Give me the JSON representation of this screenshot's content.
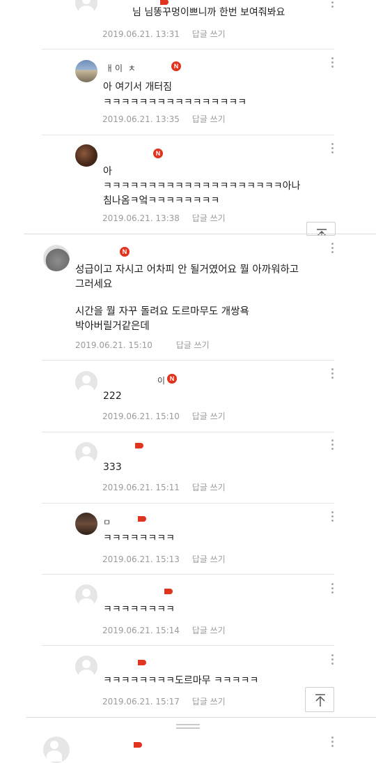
{
  "comments": [
    {
      "text": "님 님똥꾸멍이쁘니까 한번 보여줘봐요",
      "date": "2019.06.21. 13:31",
      "reply": "답글 쓰기"
    },
    {
      "nick": "ㅐ이 ㅊ",
      "badge": "N",
      "text": "아 여기서 개터짐\nㅋㅋㅋㅋㅋㅋㅋㅋㅋㅋㅋㅋㅋㅋㅋㅋ",
      "date": "2019.06.21. 13:35",
      "reply": "답글 쓰기"
    },
    {
      "badge": "N",
      "text": "아\nㅋㅋㅋㅋㅋㅋㅋㅋㅋㅋㅋㅋㅋㅋㅋㅋㅋㅋㅋㅋ아나\n침나옴ㅋ엌ㅋㅋㅋㅋㅋㅋㅋㅋ",
      "date": "2019.06.21. 13:38",
      "reply": "답글 쓰기"
    },
    {
      "badge": "N",
      "text_lines": [
        "성급이고 자시고 어차피 안 될거였어요 뭘 아까워하고",
        "그러세요",
        "",
        "시간을 뭘 자꾸 돌려요 도르마무도 개쌍욕",
        "박아버릴거같은데"
      ],
      "date": "2019.06.21. 15:10",
      "reply": "답글 쓰기"
    },
    {
      "nick": "이",
      "badge": "N",
      "text": "222",
      "date": "2019.06.21. 15:10",
      "reply": "답글 쓰기"
    },
    {
      "text": "333",
      "date": "2019.06.21. 15:11",
      "reply": "답글 쓰기"
    },
    {
      "nick": "ㅁ",
      "text": "ㅋㅋㅋㅋㅋㅋㅋㅋ",
      "date": "2019.06.21. 15:13",
      "reply": "답글 쓰기"
    },
    {
      "text": "ㅋㅋㅋㅋㅋㅋㅋㅋ",
      "date": "2019.06.21. 15:14",
      "reply": "답글 쓰기"
    },
    {
      "text": "ㅋㅋㅋㅋㅋㅋㅋㅋ도르마무 ㅋㅋㅋㅋㅋ",
      "date": "2019.06.21. 15:17",
      "reply": "답글 쓰기"
    }
  ],
  "icons": {
    "more": "more-vertical-icon",
    "scroll_top": "arrow-up-to-top-icon",
    "avatar_default": "default-user-icon"
  },
  "colors": {
    "badge": "#e0341f",
    "meta": "#9b9b9b",
    "divider": "#e4e4e4"
  }
}
